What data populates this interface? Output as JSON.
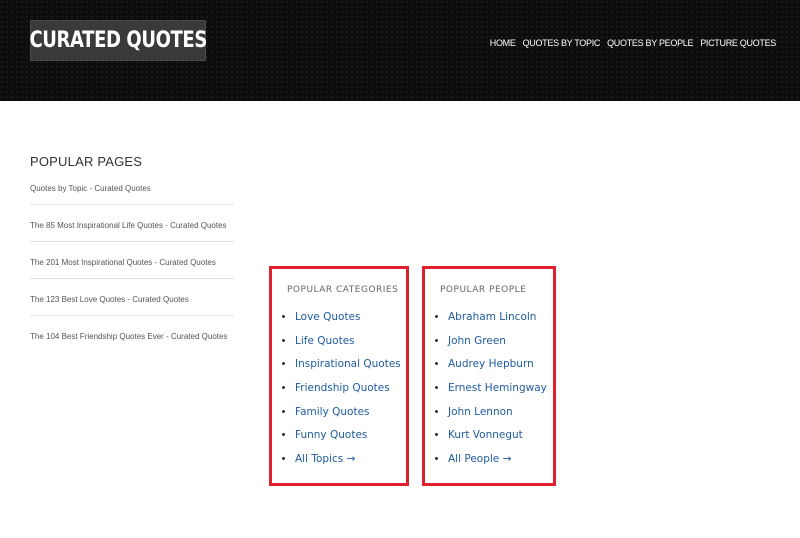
{
  "header": {
    "logo_text": "CURATED QUOTES",
    "nav": [
      "HOME",
      "QUOTES BY TOPIC",
      "QUOTES BY PEOPLE",
      "PICTURE QUOTES"
    ]
  },
  "sidebar": {
    "title": "POPULAR PAGES",
    "items": [
      "Quotes by Topic - Curated Quotes",
      "The 85 Most Inspirational Life Quotes - Curated Quotes",
      "The 201 Most Inspirational Quotes - Curated Quotes",
      "The 123 Best Love Quotes - Curated Quotes",
      "The 104 Best Friendship Quotes Ever - Curated Quotes"
    ]
  },
  "categories": {
    "title": "POPULAR CATEGORIES",
    "items": [
      "Love Quotes",
      "Life Quotes",
      "Inspirational Quotes",
      "Friendship Quotes",
      "Family Quotes",
      "Funny Quotes",
      "All Topics →"
    ]
  },
  "people": {
    "title": "POPULAR PEOPLE",
    "items": [
      "Abraham Lincoln",
      "John Green",
      "Audrey Hepburn",
      "Ernest Hemingway",
      "John Lennon",
      "Kurt Vonnegut",
      "All People →"
    ]
  },
  "colors": {
    "header_bg": "#0d0d0d",
    "link": "#1e5b9e",
    "highlight_border": "#e0202c"
  }
}
